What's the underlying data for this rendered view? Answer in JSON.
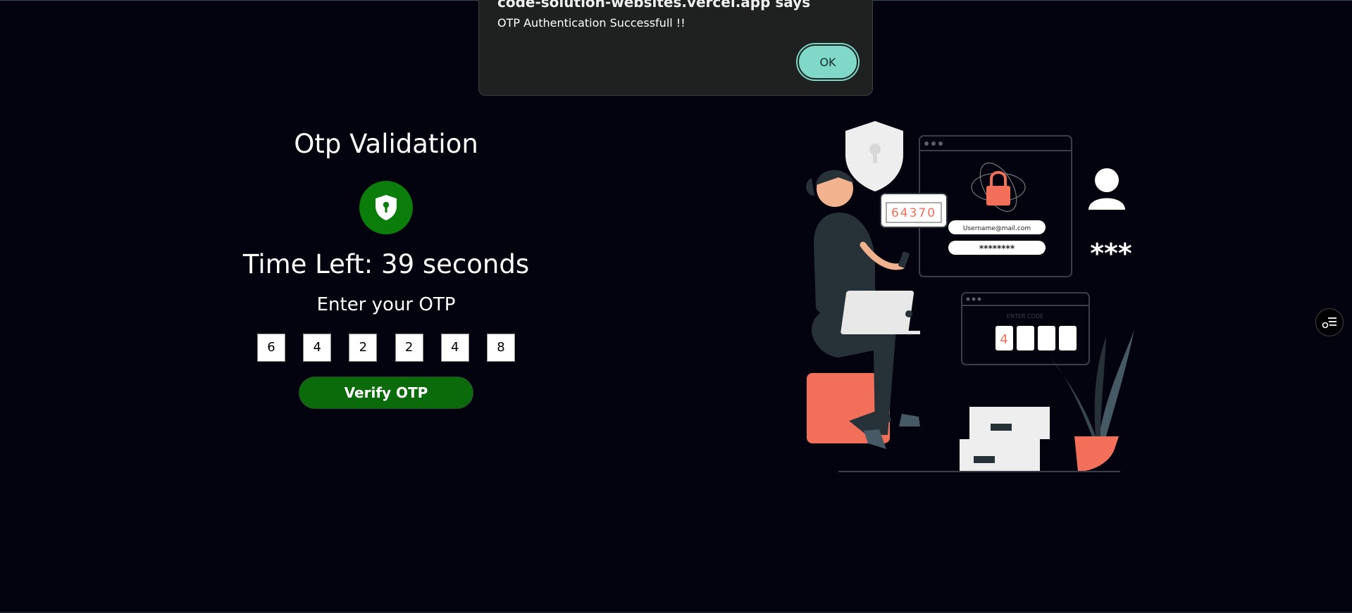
{
  "otp": {
    "title": "Otp Validation",
    "time_left": "Time Left: 39 seconds",
    "enter_label": "Enter your OTP",
    "digits": [
      "6",
      "4",
      "2",
      "2",
      "4",
      "8"
    ],
    "verify_label": "Verify OTP",
    "accent_color": "#0b7d0b"
  },
  "dialog": {
    "origin": "code-solution-websites.vercel.app says",
    "message": "OTP Authentication Successfull !!",
    "ok_label": "OK",
    "accent_color": "#7fd8c8"
  },
  "illustration": {
    "code_bubble": "64370",
    "username_field": "Username@mail.com",
    "password_field": "********",
    "enter_code_label": "ENTER CODE",
    "code_digit": "4",
    "stars": "***"
  },
  "side_fab": {
    "icon": "list-settings-icon"
  }
}
